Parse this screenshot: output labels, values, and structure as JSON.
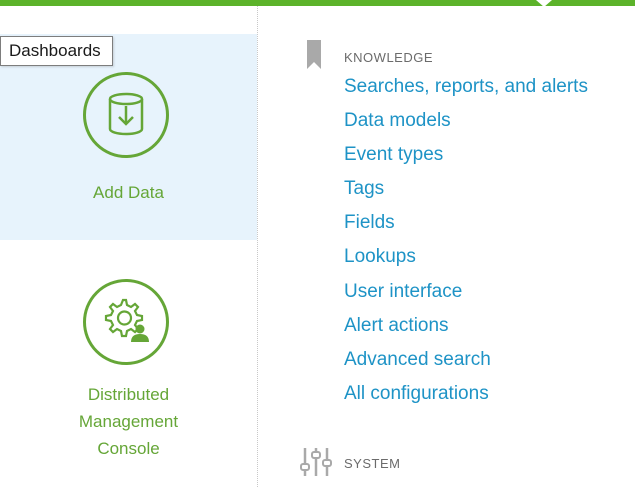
{
  "tooltip": {
    "text": "Dashboards"
  },
  "apps": [
    {
      "label_lines": [
        "Add Data"
      ],
      "icon": "database-download-icon",
      "active": true
    },
    {
      "label_lines": [
        "Distributed",
        "Management",
        "Console"
      ],
      "icon": "gear-user-icon",
      "active": false
    }
  ],
  "knowledge": {
    "icon": "bookmark-icon",
    "title": "KNOWLEDGE",
    "items": [
      "Searches, reports, and alerts",
      "Data models",
      "Event types",
      "Tags",
      "Fields",
      "Lookups",
      "User interface",
      "Alert actions",
      "Advanced search",
      "All configurations"
    ]
  },
  "system": {
    "icon": "sliders-icon",
    "title": "SYSTEM"
  },
  "colors": {
    "accent_green": "#65a637",
    "topbar_green": "#5cb32a",
    "link_blue": "#1e93c6",
    "active_tile_bg": "#e7f3fc",
    "section_grey": "#6b6b6b"
  }
}
